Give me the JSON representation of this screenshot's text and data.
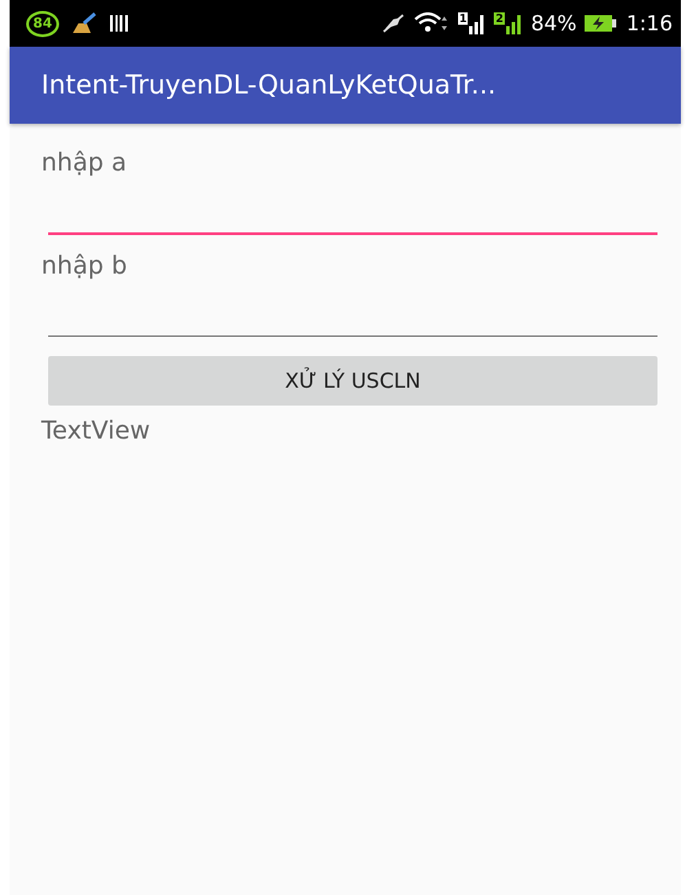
{
  "status_bar": {
    "badge": "84",
    "sims": [
      {
        "label": "1"
      },
      {
        "label": "2"
      }
    ],
    "battery": "84%",
    "time": "1:16"
  },
  "app_bar": {
    "title": "Intent-TruyenDL-QuanLyKetQuaTr..."
  },
  "fields": [
    {
      "label": "nhập a",
      "focused": true
    },
    {
      "label": "nhập b",
      "focused": false
    }
  ],
  "button": "XỬ LÝ USCLN",
  "result": "TextView"
}
